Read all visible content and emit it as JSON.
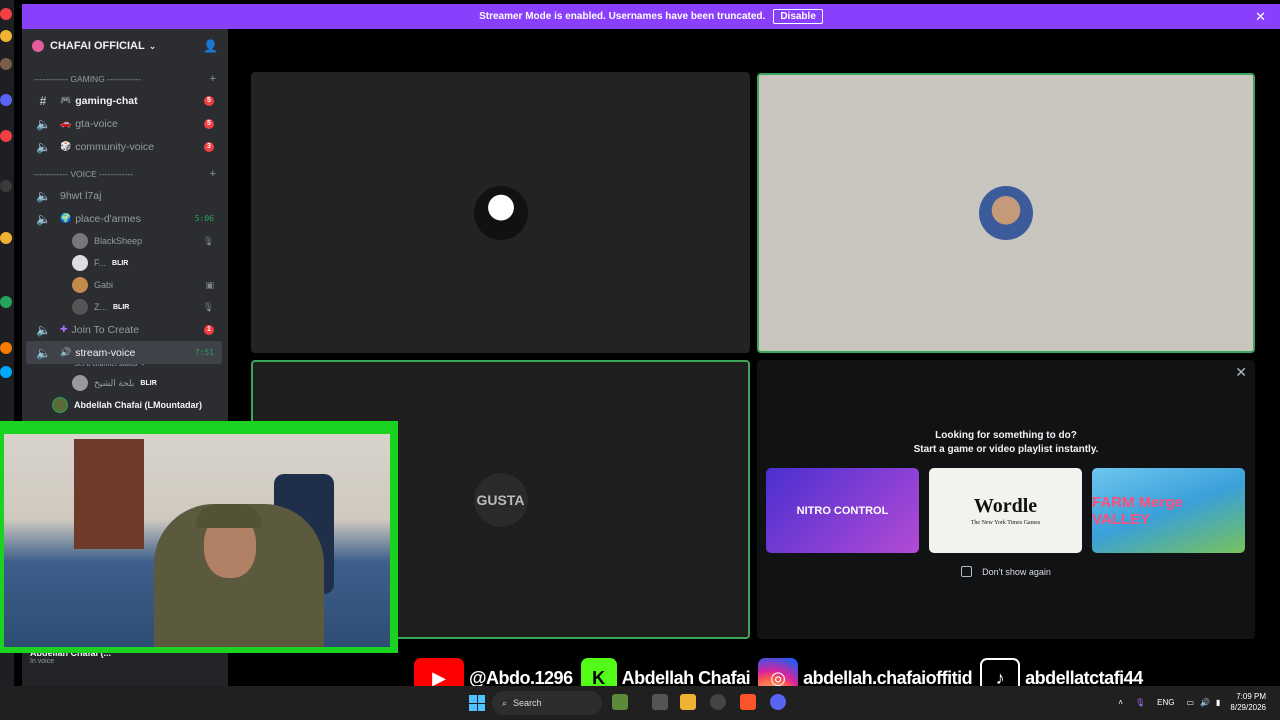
{
  "banner": {
    "message": "Streamer Mode is enabled. Usernames have been truncated.",
    "disable_label": "Disable"
  },
  "server": {
    "name": "CHAFAI OFFICIAL"
  },
  "categories": {
    "gaming": "------------ GAMING ------------",
    "voice": "------------ VOICE ------------"
  },
  "channels": [
    {
      "name": "gaming-chat",
      "badge": "5"
    },
    {
      "name": "gta-voice",
      "badge": "5"
    },
    {
      "name": "community-voice",
      "badge": "3"
    },
    {
      "name": "9hwt l7aj"
    },
    {
      "name": "place-d'armes",
      "time": "5:06"
    },
    {
      "name": "Join To Create",
      "badge": "1"
    },
    {
      "name": "stream-voice",
      "time": "7:51",
      "status": "Set a channel status"
    }
  ],
  "voice_users": [
    {
      "name": "BlackSheep"
    },
    {
      "name": "F...",
      "tag": "BLIR"
    },
    {
      "name": "Gabi"
    },
    {
      "name": "Z...",
      "tag": "BLIR"
    },
    {
      "name": "بلحة الشيخ",
      "tag": "BLIR"
    },
    {
      "name": "Abdellah Chafai (LMountadar)"
    }
  ],
  "user_panel": {
    "name": "Abdellah Chafai (...",
    "status": "In voice"
  },
  "tiles": {
    "third_label": "GUSTA"
  },
  "activity": {
    "title_line1": "Looking for something to do?",
    "title_line2": "Start a game or video playlist instantly.",
    "nitro": "NITRO CONTROL",
    "wordle": "Wordle",
    "wordle_sub": "The New York Times Games",
    "farm": "FARM Merge VALLEY",
    "dont_show": "Don't show again"
  },
  "social": {
    "youtube": "@Abdo.1296",
    "kick": "Abdellah Chafai",
    "instagram": "abdellah.chafaioffitid",
    "tiktok": "abdellatctafi44",
    "k_letter": "K"
  },
  "taskbar": {
    "search": "Search",
    "lang": "ENG",
    "time": "7:09 PM",
    "date": "8/29/2026"
  }
}
